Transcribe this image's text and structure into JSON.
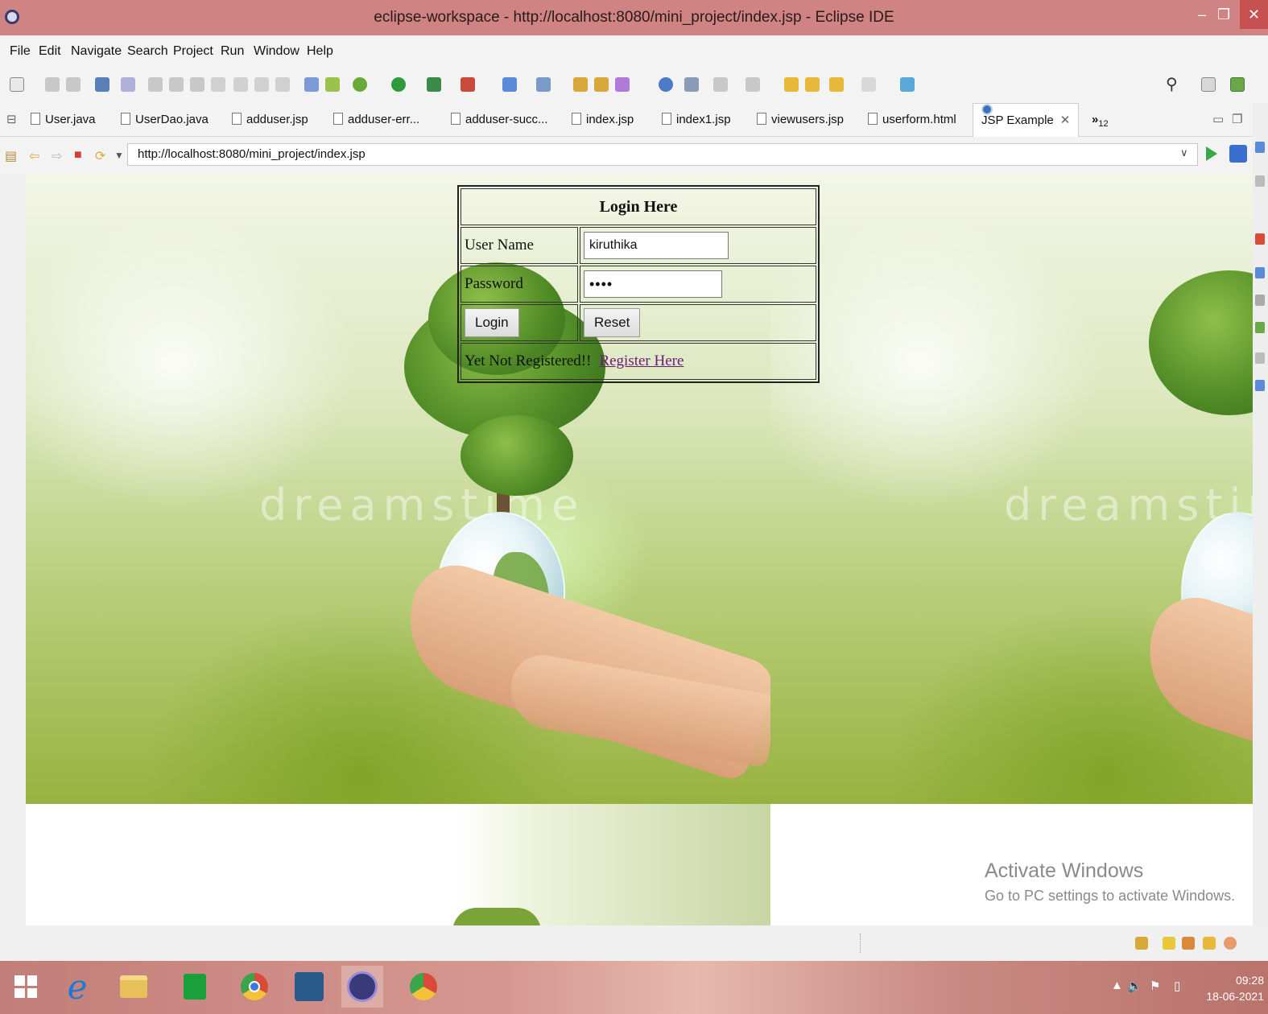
{
  "window": {
    "title": "eclipse-workspace - http://localhost:8080/mini_project/index.jsp - Eclipse IDE"
  },
  "menu": [
    "File",
    "Edit",
    "Navigate",
    "Search",
    "Project",
    "Run",
    "Window",
    "Help"
  ],
  "tabs": [
    {
      "label": "User.java",
      "icon": "java-file-icon"
    },
    {
      "label": "UserDao.java",
      "icon": "java-file-icon"
    },
    {
      "label": "adduser.jsp",
      "icon": "jsp-file-icon"
    },
    {
      "label": "adduser-err...",
      "icon": "jsp-file-icon"
    },
    {
      "label": "adduser-succ...",
      "icon": "jsp-file-icon"
    },
    {
      "label": "index.jsp",
      "icon": "jsp-file-icon"
    },
    {
      "label": "index1.jsp",
      "icon": "jsp-file-icon"
    },
    {
      "label": "viewusers.jsp",
      "icon": "jsp-file-icon"
    },
    {
      "label": "userform.html",
      "icon": "html-file-icon"
    },
    {
      "label": "JSP Example",
      "icon": "globe-icon",
      "active": true
    }
  ],
  "tabs_overflow": "»",
  "tabs_overflow_count": "12",
  "browser": {
    "url": "http://localhost:8080/mini_project/index.jsp"
  },
  "login": {
    "heading": "Login Here",
    "username_label": "User Name",
    "username_value": "kiruthika",
    "password_label": "Password",
    "password_value": "••••",
    "login_button": "Login",
    "reset_button": "Reset",
    "not_registered_text": "Yet Not Registered!!",
    "register_link": "Register Here"
  },
  "background_watermark": "dreamstime",
  "activate_windows": {
    "line1": "Activate Windows",
    "line2": "Go to PC settings to activate Windows."
  },
  "taskbar": {
    "time": "09:28",
    "date": "18-06-2021"
  },
  "colors": {
    "titlebar": "#cf8383",
    "link": "#6a1b7a",
    "go_button": "#3aa54a"
  }
}
